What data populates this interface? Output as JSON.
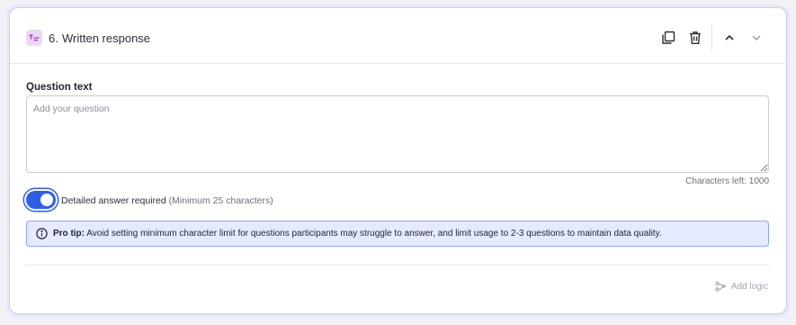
{
  "question": {
    "number": "6.",
    "title": "Written response",
    "type_icon": "written-response-icon",
    "type_icon_bg": "#ecd7f6",
    "type_icon_fg": "#9b3fc4"
  },
  "header_actions": {
    "duplicate_icon": "duplicate-icon",
    "delete_icon": "trash-icon",
    "move_up_icon": "chevron-up-icon",
    "move_down_icon": "chevron-down-icon"
  },
  "question_text": {
    "label": "Question text",
    "placeholder": "Add your question",
    "value": "",
    "chars_left": "Characters left: 1000"
  },
  "detailed_answer": {
    "enabled": true,
    "label": "Detailed answer required",
    "sublabel": "(Minimum 25 characters)"
  },
  "pro_tip": {
    "icon": "info-icon",
    "title": "Pro tip:",
    "text": "Avoid setting minimum character limit for questions participants may struggle to answer, and limit usage to 2-3 questions to maintain data quality."
  },
  "footer": {
    "add_logic_label": "Add logic",
    "add_logic_icon": "branch-logic-icon"
  },
  "colors": {
    "accent": "#2f5fe6",
    "card_border": "#c9cdf3",
    "tip_bg": "#e5eaff",
    "tip_border": "#8fa6ef",
    "disabled_text": "#a3a6b0"
  }
}
